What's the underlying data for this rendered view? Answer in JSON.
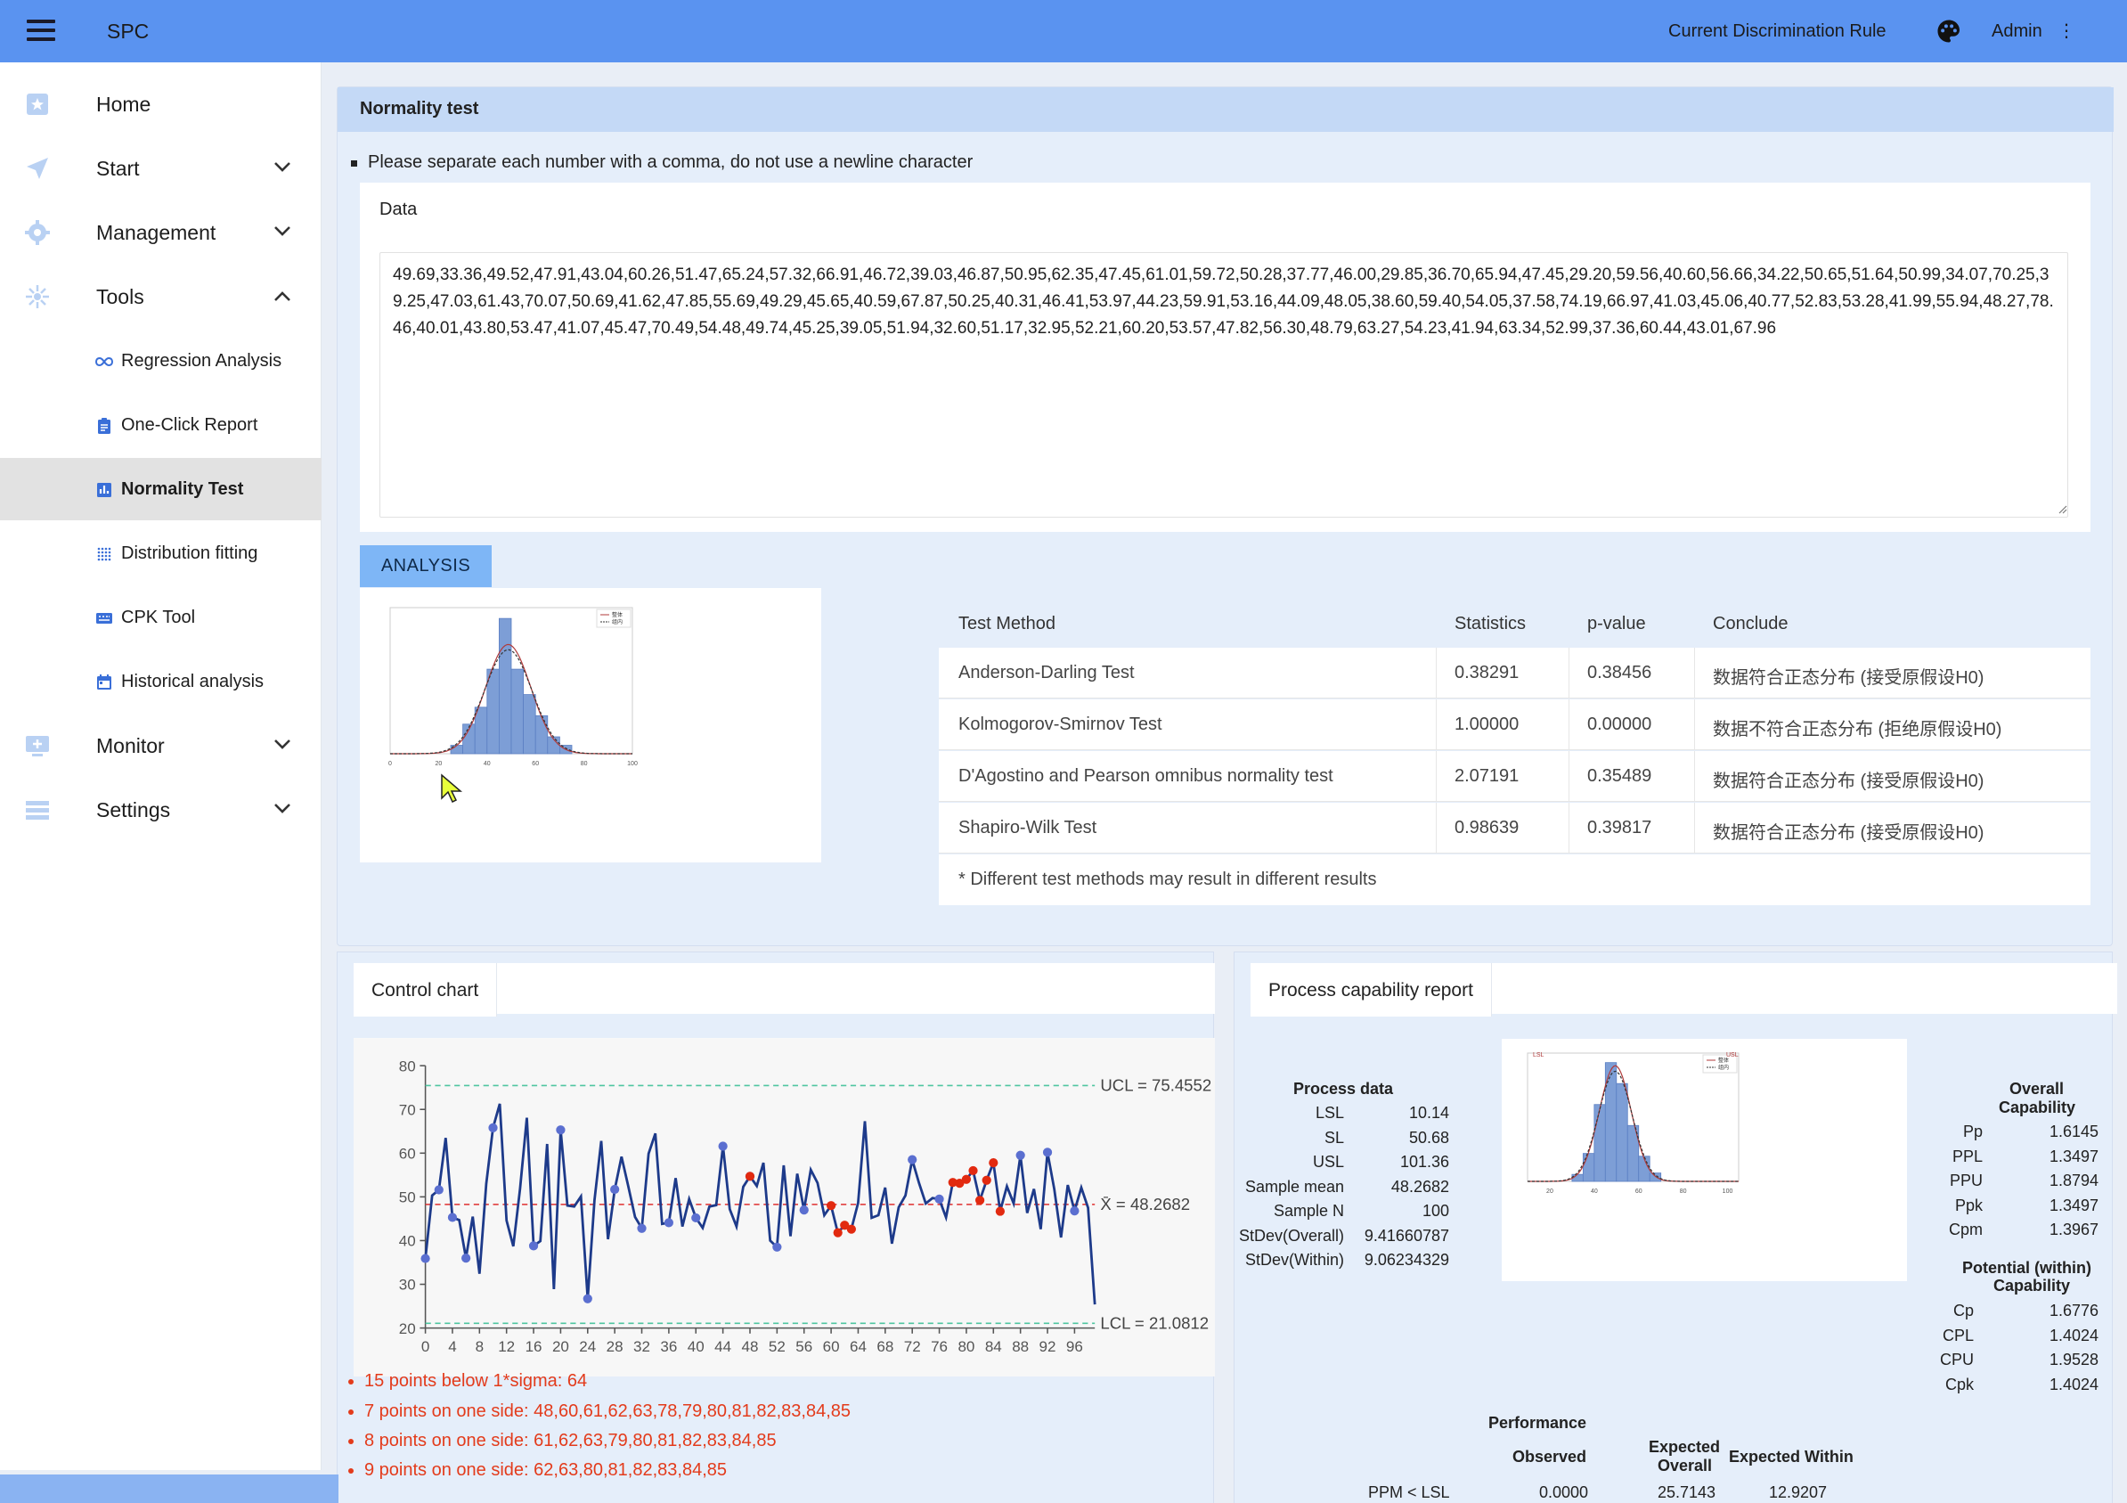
{
  "app": {
    "title": "SPC",
    "rule_link": "Current Discrimination Rule",
    "user": "Admin",
    "user_menu_glyph": "⋮"
  },
  "sidebar": {
    "home": "Home",
    "start": "Start",
    "management": "Management",
    "tools": "Tools",
    "sub": [
      "Regression Analysis",
      "One-Click Report",
      "Normality Test",
      "Distribution fitting",
      "CPK Tool",
      "Historical analysis"
    ],
    "monitor": "Monitor",
    "settings": "Settings"
  },
  "normality": {
    "header": "Normality test",
    "tip": "Please separate each number with a comma, do not use a newline character",
    "data_label": "Data",
    "data_value": "49.69,33.36,49.52,47.91,43.04,60.26,51.47,65.24,57.32,66.91,46.72,39.03,46.87,50.95,62.35,47.45,61.01,59.72,50.28,37.77,46.00,29.85,36.70,65.94,47.45,29.20,59.56,40.60,56.66,34.22,50.65,51.64,50.99,34.07,70.25,39.25,47.03,61.43,70.07,50.69,41.62,47.85,55.69,49.29,45.65,40.59,67.87,50.25,40.31,46.41,53.97,44.23,59.91,53.16,44.09,48.05,38.60,59.40,54.05,37.58,74.19,66.97,41.03,45.06,40.77,52.83,53.28,41.99,55.94,48.27,78.46,40.01,43.80,53.47,41.07,45.47,70.49,54.48,49.74,45.25,39.05,51.94,32.60,51.17,32.95,52.21,60.20,53.57,47.82,56.30,48.79,63.27,54.23,41.94,63.34,52.99,37.36,60.44,43.01,67.96",
    "analysis_btn": "ANALYSIS",
    "table_headers": [
      "Test Method",
      "Statistics",
      "p-value",
      "Conclude"
    ],
    "rows": [
      {
        "method": "Anderson-Darling Test",
        "stat": "0.38291",
        "p": "0.38456",
        "conclude": "数据符合正态分布 (接受原假设H0)"
      },
      {
        "method": "Kolmogorov-Smirnov Test",
        "stat": "1.00000",
        "p": "0.00000",
        "conclude": "数据不符合正态分布 (拒绝原假设H0)"
      },
      {
        "method": "D'Agostino and Pearson omnibus normality test",
        "stat": "2.07191",
        "p": "0.35489",
        "conclude": "数据符合正态分布 (接受原假设H0)"
      },
      {
        "method": "Shapiro-Wilk Test",
        "stat": "0.98639",
        "p": "0.39817",
        "conclude": "数据符合正态分布 (接受原假设H0)"
      }
    ],
    "note": "* Different test methods may result in different results"
  },
  "control": {
    "tab": "Control chart",
    "ucl_label": "UCL = 75.4552",
    "cl_label": "X̄  = 48.2682",
    "lcl_label": "LCL = 21.0812",
    "violations": [
      "15 points below 1*sigma: 64",
      "7 points on one side: 48,60,61,62,63,78,79,80,81,82,83,84,85",
      "8 points on one side: 61,62,63,79,80,81,82,83,84,85",
      "9 points on one side: 62,63,80,81,82,83,84,85"
    ]
  },
  "capability": {
    "tab": "Process capability report",
    "process_title": "Process data",
    "process": [
      [
        "LSL",
        "10.14"
      ],
      [
        "SL",
        "50.68"
      ],
      [
        "USL",
        "101.36"
      ],
      [
        "Sample mean",
        "48.2682"
      ],
      [
        "Sample N",
        "100"
      ],
      [
        "StDev(Overall)",
        "9.41660787"
      ],
      [
        "StDev(Within)",
        "9.06234329"
      ]
    ],
    "overall_title_1": "Overall",
    "overall_title_2": "Capability",
    "overall": [
      [
        "Pp",
        "1.6145"
      ],
      [
        "PPL",
        "1.3497"
      ],
      [
        "PPU",
        "1.8794"
      ],
      [
        "Ppk",
        "1.3497"
      ],
      [
        "Cpm",
        "1.3967"
      ]
    ],
    "potential_title_1": "Potential (within)",
    "potential_title_2": "Capability",
    "potential": [
      [
        "Cp",
        "1.6776"
      ],
      [
        "CPL",
        "1.4024"
      ],
      [
        "CPU",
        "1.9528"
      ],
      [
        "Cpk",
        "1.4024"
      ]
    ],
    "performance_title": "Performance",
    "perf_headers": [
      "Observed",
      "Expected",
      "Overall",
      "Expected Within"
    ],
    "perf_row": [
      "PPM < LSL",
      "0.0000",
      "25.7143",
      "12.9207"
    ],
    "hist_lsl": "LSL",
    "hist_usl": "USL"
  },
  "chart_data": [
    {
      "type": "line",
      "title": "",
      "ylim": [
        20,
        80
      ],
      "xlim": [
        0,
        99
      ],
      "x_ticks": [
        0,
        4,
        8,
        12,
        16,
        20,
        24,
        28,
        32,
        36,
        40,
        44,
        48,
        52,
        56,
        60,
        64,
        68,
        72,
        76,
        80,
        84,
        88,
        92,
        96
      ],
      "y_ticks": [
        20,
        30,
        40,
        50,
        60,
        70,
        80
      ],
      "ucl": 75.4552,
      "center": 48.2682,
      "lcl": 21.0812,
      "values": [
        35.9,
        50.3,
        51.6,
        63.5,
        45.3,
        44.7,
        36.0,
        45.5,
        32.4,
        53.0,
        65.8,
        71.3,
        44.6,
        38.7,
        51.9,
        68.1,
        38.8,
        39.9,
        62.1,
        28.9,
        65.3,
        48.0,
        47.8,
        50.1,
        26.7,
        49.2,
        62.8,
        40.3,
        51.7,
        59.2,
        52.4,
        45.4,
        42.8,
        59.9,
        64.5,
        43.8,
        44.1,
        54.3,
        43.2,
        49.5,
        45.2,
        42.9,
        47.8,
        48.1,
        61.6,
        47.2,
        43.2,
        52.3,
        54.7,
        52.5,
        57.8,
        40.0,
        38.5,
        57.2,
        41.0,
        55.3,
        47.0,
        56.2,
        53.2,
        45.8,
        48.0,
        41.8,
        43.5,
        42.6,
        48.6,
        67.3,
        45.2,
        45.8,
        52.1,
        39.3,
        47.6,
        50.3,
        58.5,
        53.2,
        48.5,
        49.7,
        49.5,
        45.3,
        53.3,
        53.1,
        54.0,
        56.0,
        49.2,
        53.8,
        57.8,
        46.7,
        52.4,
        48.5,
        59.5,
        46.3,
        51.8,
        42.6,
        60.2,
        51.8,
        40.7,
        52.7,
        46.8,
        52.1,
        47.5,
        25.4
      ],
      "marked_points_blue": [
        0,
        2,
        4,
        6,
        10,
        16,
        20,
        24,
        28,
        32,
        36,
        40,
        44,
        48,
        52,
        56,
        72,
        76,
        88,
        92,
        96
      ],
      "marked_points_red": [
        48,
        60,
        61,
        62,
        63,
        78,
        79,
        80,
        81,
        82,
        83,
        84,
        85
      ]
    },
    {
      "type": "bar",
      "title": "",
      "legend": [
        "整体",
        "组内"
      ],
      "legend_position": "top-right",
      "x_ticks": [
        0,
        20,
        40,
        60,
        80,
        100
      ],
      "bin_edges": [
        25,
        30,
        35,
        40,
        45,
        50,
        55,
        60,
        65,
        70,
        75,
        80
      ],
      "values": [
        2,
        7,
        11,
        20,
        32,
        20,
        14,
        9,
        4,
        2,
        0
      ]
    },
    {
      "type": "bar",
      "title": "",
      "legend": [
        "整体",
        "组内"
      ],
      "legend_position": "top-right",
      "x_ticks": [
        20,
        40,
        60,
        80,
        100
      ],
      "bin_edges": [
        30,
        35,
        40,
        45,
        50,
        55,
        60,
        65,
        70
      ],
      "values": [
        5,
        20,
        55,
        85,
        70,
        40,
        18,
        6
      ]
    }
  ]
}
